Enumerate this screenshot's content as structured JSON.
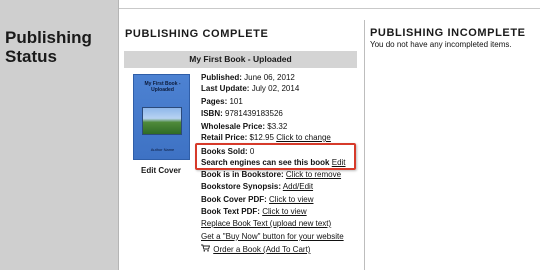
{
  "sidebar": {
    "title": "Publishing Status"
  },
  "complete": {
    "heading": "PUBLISHING COMPLETE"
  },
  "incomplete": {
    "heading": "PUBLISHING INCOMPLETE",
    "message": "You do not have any incompleted items."
  },
  "book": {
    "header": "My First Book - Uploaded",
    "cover_title": "My First Book - Uploaded",
    "cover_author": "Author Name",
    "edit_cover": "Edit Cover",
    "published_label": "Published:",
    "published_value": "June 06, 2012",
    "last_update_label": "Last Update:",
    "last_update_value": "July 02, 2014",
    "pages_label": "Pages:",
    "pages_value": "101",
    "isbn_label": "ISBN:",
    "isbn_value": "9781439183526",
    "wholesale_label": "Wholesale Price:",
    "wholesale_value": "$3.32",
    "retail_label": "Retail Price:",
    "retail_value": "$12.95",
    "retail_link": "Click to change",
    "sold_label": "Books Sold:",
    "sold_value": "0",
    "search_label": "Search engines can see this book",
    "search_link": "Edit",
    "bookstore_label": "Book is in Bookstore:",
    "bookstore_link": "Click to remove",
    "synopsis_label": "Bookstore Synopsis:",
    "synopsis_link": "Add/Edit",
    "cover_pdf_label": "Book Cover PDF:",
    "cover_pdf_link": "Click to view",
    "text_pdf_label": "Book Text PDF:",
    "text_pdf_link": "Click to view",
    "replace_link": "Replace Book Text (upload new text)",
    "buy_now_link": "Get a \"Buy Now\" button for your website",
    "order_link": "Order a Book (Add To Cart)"
  },
  "colors": {
    "sidebar": "#cfcfcf",
    "header_bar": "#d4d4d4",
    "highlight": "#d63a2a",
    "cover": "#4d82d2"
  },
  "icons": {
    "cart": "shopping-cart-icon"
  }
}
